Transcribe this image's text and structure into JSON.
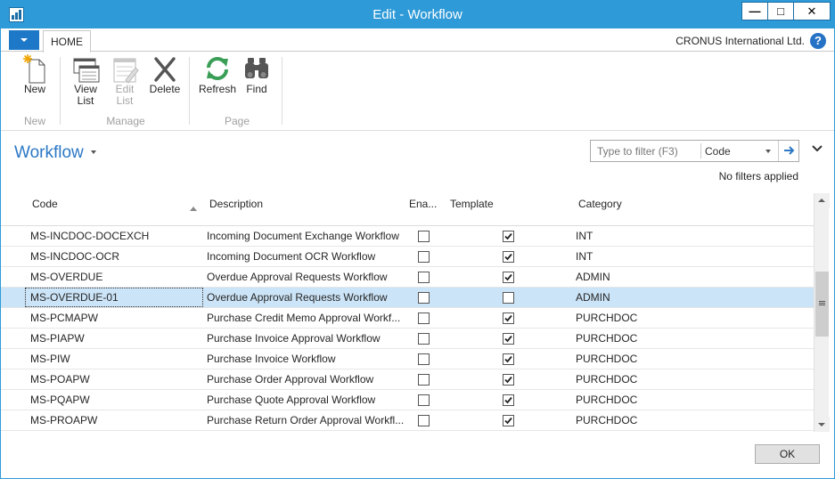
{
  "window": {
    "title": "Edit - Workflow",
    "minimize_glyph": "—",
    "maximize_glyph": "□",
    "close_glyph": "✕"
  },
  "ribbon_tabs": {
    "home_label": "HOME",
    "company": "CRONUS International Ltd.",
    "help_glyph": "?"
  },
  "ribbon": {
    "groups": [
      {
        "label": "New"
      },
      {
        "label": "Manage"
      },
      {
        "label": "Page"
      }
    ],
    "buttons": {
      "new": "New",
      "view_list_1": "View",
      "view_list_2": "List",
      "edit_list_1": "Edit",
      "edit_list_2": "List",
      "delete": "Delete",
      "refresh": "Refresh",
      "find": "Find"
    }
  },
  "page": {
    "title": "Workflow",
    "filter_placeholder": "Type to filter (F3)",
    "filter_field": "Code",
    "no_filters": "No filters applied"
  },
  "grid": {
    "columns": {
      "code": "Code",
      "description": "Description",
      "enabled": "Ena...",
      "template": "Template",
      "category": "Category"
    },
    "rows": [
      {
        "code": "MS-INCDOC-DOCEXCH",
        "description": "Incoming Document Exchange Workflow",
        "enabled": false,
        "template": true,
        "category": "INT"
      },
      {
        "code": "MS-INCDOC-OCR",
        "description": "Incoming Document OCR Workflow",
        "enabled": false,
        "template": true,
        "category": "INT"
      },
      {
        "code": "MS-OVERDUE",
        "description": "Overdue Approval Requests Workflow",
        "enabled": false,
        "template": true,
        "category": "ADMIN"
      },
      {
        "code": "MS-OVERDUE-01",
        "description": "Overdue Approval Requests Workflow",
        "enabled": false,
        "template": false,
        "category": "ADMIN",
        "selected": true
      },
      {
        "code": "MS-PCMAPW",
        "description": "Purchase Credit Memo Approval Workf...",
        "enabled": false,
        "template": true,
        "category": "PURCHDOC"
      },
      {
        "code": "MS-PIAPW",
        "description": "Purchase Invoice Approval Workflow",
        "enabled": false,
        "template": true,
        "category": "PURCHDOC"
      },
      {
        "code": "MS-PIW",
        "description": "Purchase Invoice Workflow",
        "enabled": false,
        "template": true,
        "category": "PURCHDOC"
      },
      {
        "code": "MS-POAPW",
        "description": "Purchase Order Approval Workflow",
        "enabled": false,
        "template": true,
        "category": "PURCHDOC"
      },
      {
        "code": "MS-PQAPW",
        "description": "Purchase Quote Approval Workflow",
        "enabled": false,
        "template": true,
        "category": "PURCHDOC"
      },
      {
        "code": "MS-PROAPW",
        "description": "Purchase Return Order Approval Workfl...",
        "enabled": false,
        "template": true,
        "category": "PURCHDOC"
      }
    ]
  },
  "footer": {
    "ok_label": "OK"
  },
  "colors": {
    "titlebar": "#2e9ad8",
    "accent": "#2b78c5",
    "selected_row": "#cce4f7",
    "refresh_green": "#3a9e57"
  }
}
